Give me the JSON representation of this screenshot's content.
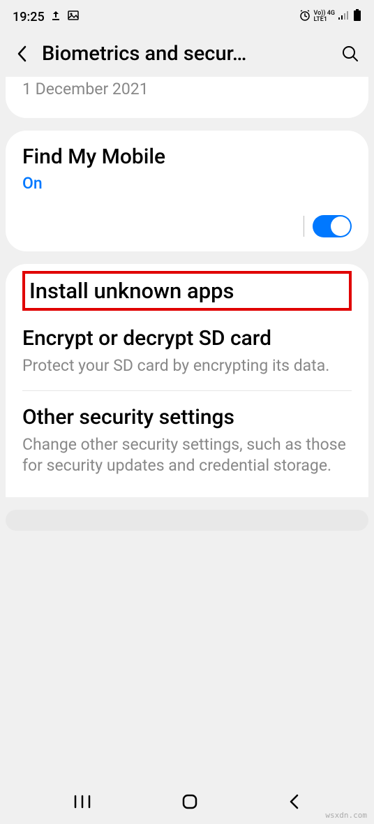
{
  "status": {
    "time": "19:25",
    "indicators": "Vo)) 4G .ıl",
    "lte": "LTE1"
  },
  "header": {
    "title": "Biometrics and secur…"
  },
  "partial_top": {
    "date": "1 December 2021"
  },
  "find_mobile": {
    "title": "Find My Mobile",
    "status": "On"
  },
  "install_unknown": {
    "title": "Install unknown apps"
  },
  "encrypt": {
    "title": "Encrypt or decrypt SD card",
    "desc": "Protect your SD card by encrypting its data."
  },
  "other": {
    "title": "Other security settings",
    "desc": "Change other security settings, such as those for security updates and credential storage."
  },
  "watermark": "wsxdn.com"
}
